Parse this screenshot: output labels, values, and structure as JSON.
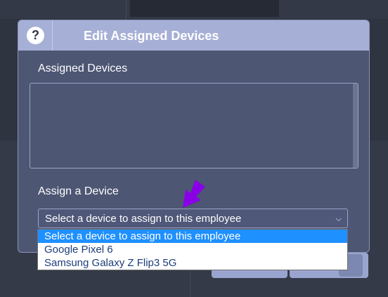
{
  "modal": {
    "title": "Edit Assigned Devices",
    "help_icon": "?",
    "assigned_devices_label": "Assigned Devices",
    "assign_device_label": "Assign a Device",
    "select_value": "Select a device to assign to this employee"
  },
  "dropdown": {
    "options": [
      "Select a device to assign to this employee",
      "Google Pixel 6",
      "Samsung Galaxy Z Flip3 5G"
    ],
    "selected_index": 0
  },
  "colors": {
    "header": "#a6afd6",
    "modal_body": "#4d5673",
    "highlight": "#1e90ff",
    "arrow": "#8a00e6"
  },
  "icons": [
    "help-icon",
    "chevron-down-icon",
    "arrow-pointer-icon"
  ]
}
